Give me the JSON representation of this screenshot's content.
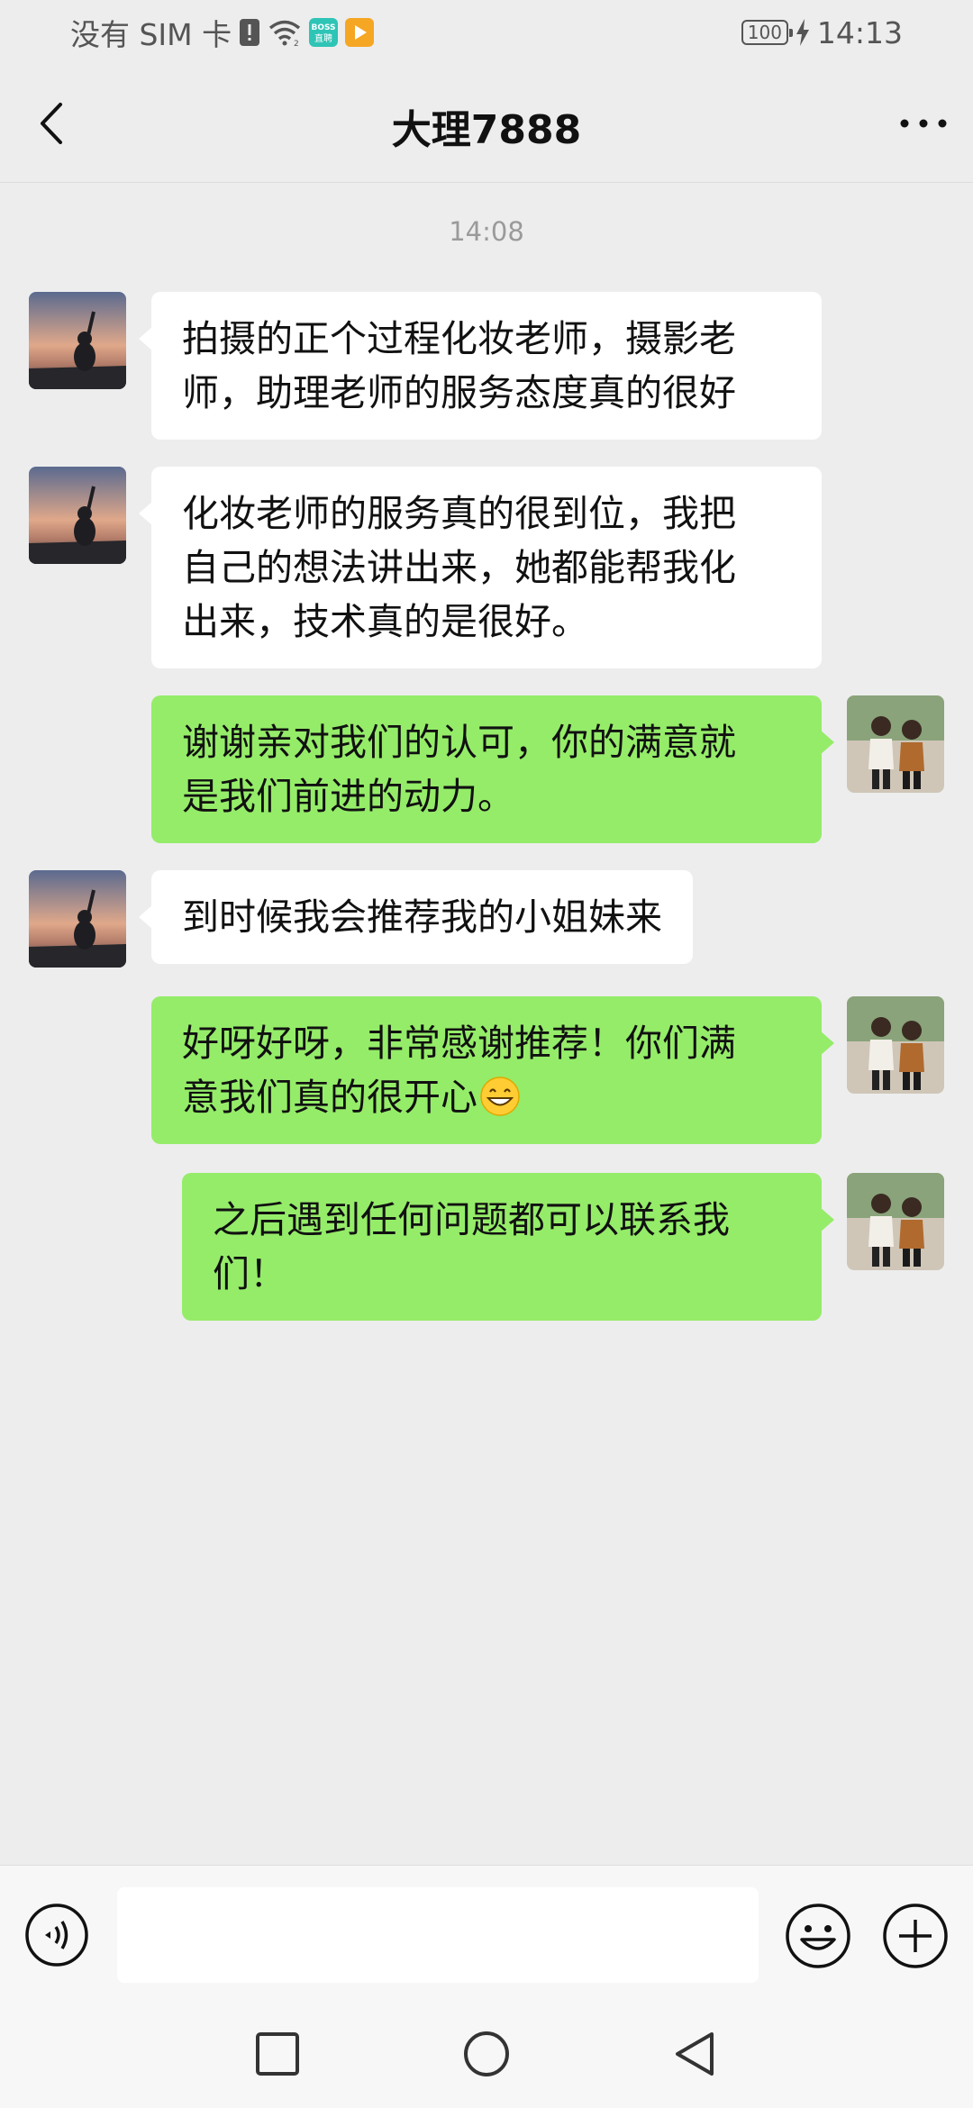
{
  "status_bar": {
    "carrier": "没有 SIM 卡",
    "battery": "100",
    "time": "14:13",
    "boss_app_label": "BOSS\n直聘"
  },
  "header": {
    "title": "大理7888"
  },
  "chat": {
    "timestamp": "14:08",
    "messages": [
      {
        "side": "in",
        "lines": [
          "拍摄的正个过程化妆老师，摄影老",
          "师，助理老师的服务态度真的很好"
        ]
      },
      {
        "side": "in",
        "lines": [
          "化妆老师的服务真的很到位，我把",
          "自己的想法讲出来，她都能帮我化",
          "出来，技术真的是很好。"
        ]
      },
      {
        "side": "out",
        "lines": [
          "谢谢亲对我们的认可，你的满意就",
          "是我们前进的动力。"
        ]
      },
      {
        "side": "in",
        "lines": [
          "到时候我会推荐我的小姐妹来"
        ]
      },
      {
        "side": "out",
        "lines": [
          "好呀好呀，非常感谢推荐！你们满",
          "意我们真的很开心"
        ],
        "emoji": "grinning-face-emoji"
      },
      {
        "side": "out",
        "lines": [
          "之后遇到任何问题都可以联系我",
          "们！"
        ]
      }
    ]
  },
  "input_bar": {
    "placeholder": ""
  },
  "colors": {
    "background": "#ededed",
    "incoming_bubble": "#ffffff",
    "outgoing_bubble": "#95ec69"
  }
}
